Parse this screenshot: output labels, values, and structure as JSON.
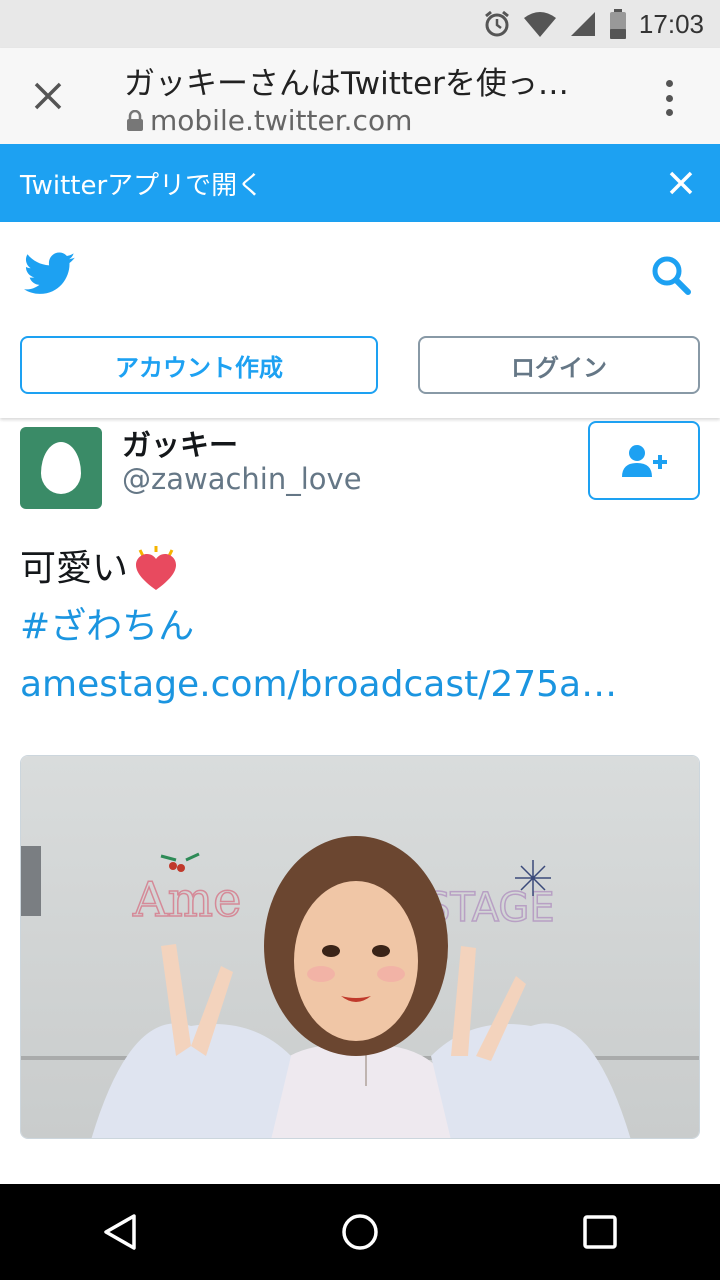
{
  "status_bar": {
    "time": "17:03"
  },
  "browser": {
    "page_title": "ガッキーさんはTwitterを使っ…",
    "url": "mobile.twitter.com"
  },
  "banner": {
    "text": "Twitterアプリで開く"
  },
  "header": {
    "signup_label": "アカウント作成",
    "login_label": "ログイン"
  },
  "tweet": {
    "display_name": "ガッキー",
    "username": "@zawachin_love",
    "text_line1": "可愛い",
    "hashtag": "#ざわちん",
    "link": "amestage.com/broadcast/275a…",
    "media_overlay_left": "Ame",
    "media_overlay_right": "STAGE"
  },
  "colors": {
    "twitter_blue": "#1da1f2",
    "link_blue": "#1b95e0",
    "avatar_green": "#3a8b67"
  },
  "icons": [
    "alarm-icon",
    "wifi-icon",
    "signal-icon",
    "battery-icon",
    "close-icon",
    "lock-icon",
    "more-vert-icon",
    "twitter-bird-icon",
    "search-icon",
    "follow-icon",
    "heart-emoji",
    "nav-back-icon",
    "nav-home-icon",
    "nav-recents-icon"
  ]
}
